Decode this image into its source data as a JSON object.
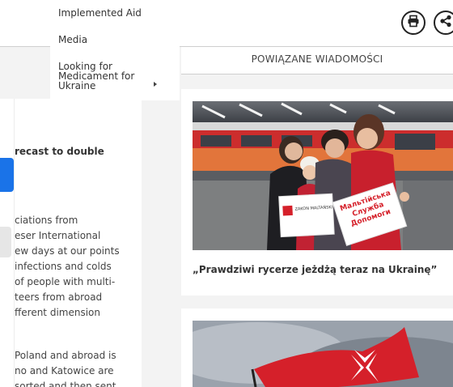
{
  "menu": {
    "items": [
      {
        "label": "Implemented Aid"
      },
      {
        "label": "Media"
      },
      {
        "label": "Looking for Medicament for Ukraine"
      }
    ]
  },
  "actions": {
    "print_icon": "printer-icon",
    "share_icon": "share-icon"
  },
  "related": {
    "heading": "POWIĄZANE WIADOMOŚCI",
    "cards": [
      {
        "title": "„Prawdziwi rycerze jeżdżą teraz na Ukrainę”",
        "image": "volunteers-at-train-photo",
        "sign_left": "ZAKON MALTAŃSKI",
        "sign_right": "Мальтійська Служба Допомоги"
      },
      {
        "title": "",
        "image": "maltese-flag-photo"
      }
    ]
  },
  "article": {
    "lead_title": "recast to double",
    "paragraph1": [
      "ciations from",
      "eser International",
      "ew days at our points",
      "infections and colds",
      " of people with multi-",
      "teers from abroad",
      "fferent dimension"
    ],
    "paragraph2": [
      "Poland and abroad is",
      "no and Katowice are",
      "sorted and then sent"
    ]
  },
  "colors": {
    "accent_blue": "#1a73e8",
    "flag_red": "#d5202a",
    "train_orange": "#e2753b"
  }
}
